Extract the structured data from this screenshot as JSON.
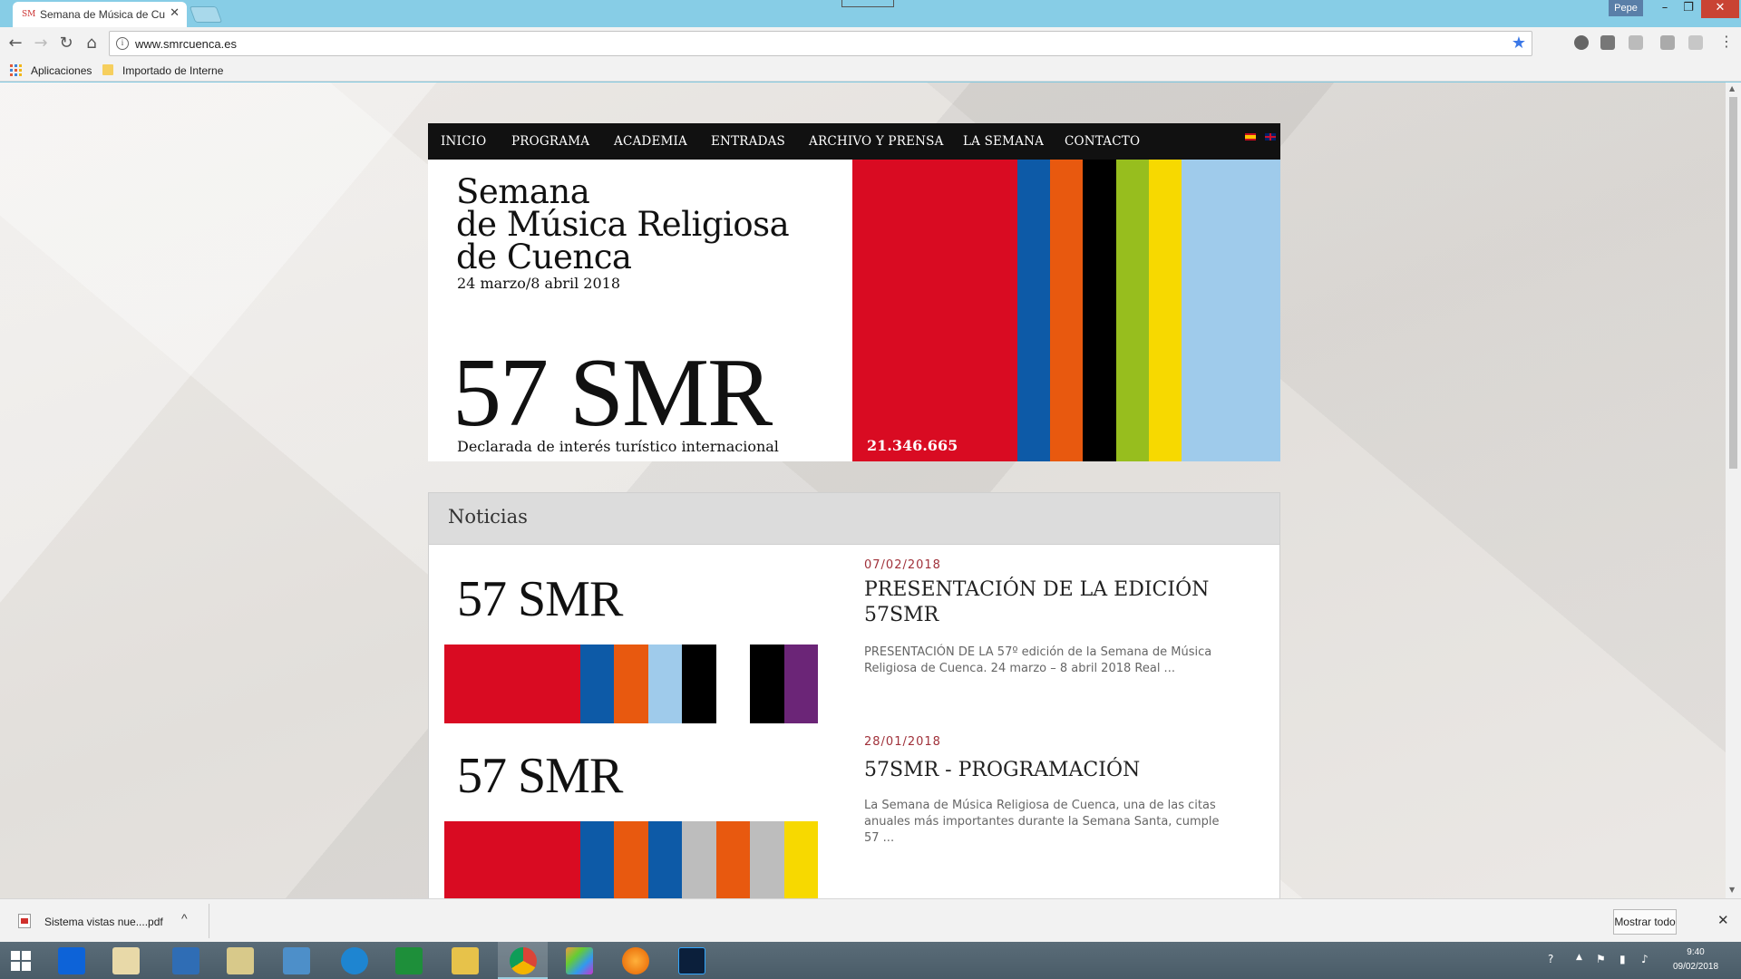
{
  "browser": {
    "tab_title": "Semana de Música de Cu",
    "favicon_text": "SM",
    "profile": "Pepe",
    "url": "www.smrcuenca.es"
  },
  "bookmarks": {
    "apps": "Aplicaciones",
    "folder": "Importado de Interne"
  },
  "site": {
    "nav": [
      "INICIO",
      "PROGRAMA",
      "ACADEMIA",
      "ENTRADAS",
      "ARCHIVO Y PRENSA",
      "LA SEMANA",
      "CONTACTO"
    ],
    "hero": {
      "title_line1": "Semana",
      "title_line2": "de Música Religiosa",
      "title_line3": "de Cuenca",
      "dates": "24 marzo/8 abril 2018",
      "big": "57 SMR",
      "declared": "Declarada de interés turístico internacional",
      "counter": "21.346.665",
      "stripe_colors": [
        "#d90b22",
        "#d90b22",
        "#d90b22",
        "#d90b22",
        "#d90b22",
        "#0d5aa7",
        "#e8590f",
        "#000000",
        "#97be1e",
        "#f7d900",
        "#9fcbeb",
        "#9fcbeb",
        "#9fcbeb"
      ]
    },
    "news": {
      "heading": "Noticias",
      "items": [
        {
          "thumb_title": "57 SMR",
          "bars": [
            "#d90b22",
            "#d90b22",
            "#d90b22",
            "#d90b22",
            "#0d5aa7",
            "#e8590f",
            "#9fcbeb",
            "#000000",
            "#ffffff",
            "#000000",
            "#6b2577"
          ],
          "date": "07/02/2018",
          "title": "PRESENTACIÓN DE LA EDICIÓN 57SMR",
          "excerpt": "PRESENTACIÓN DE LA 57º edición de la Semana de Música Religiosa de Cuenca. 24 marzo – 8 abril 2018 Real ..."
        },
        {
          "thumb_title": "57 SMR",
          "bars": [
            "#d90b22",
            "#d90b22",
            "#d90b22",
            "#d90b22",
            "#0d5aa7",
            "#e8590f",
            "#0d5aa7",
            "#bdbdbd",
            "#e8590f",
            "#bdbdbd",
            "#f7d900"
          ],
          "date": "28/01/2018",
          "title": "57SMR - PROGRAMACIÓN",
          "excerpt": "La Semana de Música Religiosa de Cuenca, una de las citas anuales más importantes durante la Semana Santa, cumple 57 ..."
        }
      ]
    }
  },
  "downloads": {
    "file": "Sistema vistas nue....pdf",
    "show_all": "Mostrar todo"
  },
  "taskbar": {
    "time": "9:40",
    "date": "09/02/2018"
  },
  "icons": [
    "back-icon",
    "forward-icon",
    "reload-icon",
    "home-icon",
    "info-icon",
    "star-icon",
    "apps-icon",
    "folder-icon",
    "pdf-icon",
    "windows-start-icon"
  ]
}
